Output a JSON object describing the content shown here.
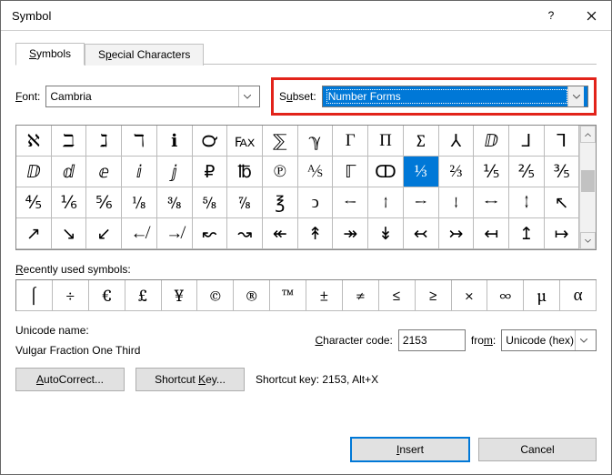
{
  "title": "Symbol",
  "tabs": {
    "symbols": "Symbols",
    "special": "Special Characters"
  },
  "font": {
    "label": "Font:",
    "value": "Cambria"
  },
  "subset": {
    "label": "Subset:",
    "value": "Number Forms"
  },
  "grid": [
    "ℵ",
    "ℶ",
    "ℷ",
    "ℸ",
    "ℹ",
    "℺",
    "℻",
    "⅀",
    "ℽ",
    "Γ",
    "Π",
    "∑",
    "⅄",
    "ⅅ",
    "⅃",
    "⅂",
    "ⅅ",
    "ⅆ",
    "ⅇ",
    "ⅈ",
    "ⅉ",
    "₽",
    "℔",
    "℗",
    "⅍",
    "ℾ",
    "ↀ",
    "⅓",
    "⅔",
    "⅕",
    "⅖",
    "⅗",
    "⅘",
    "⅙",
    "⅚",
    "⅛",
    "⅜",
    "⅝",
    "⅞",
    "℥",
    "ↄ",
    "←",
    "↑",
    "→",
    "↓",
    "↔",
    "↕",
    "↖",
    "↗",
    "↘",
    "↙",
    "↚",
    "↛",
    "↜",
    "↝",
    "↞",
    "↟",
    "↠",
    "↡",
    "↢",
    "↣",
    "↤",
    "↥",
    "↦"
  ],
  "grid_selected_index": 27,
  "recent_label": "Recently used symbols:",
  "recent": [
    "⌠",
    "÷",
    "€",
    "£",
    "¥",
    "©",
    "®",
    "™",
    "±",
    "≠",
    "≤",
    "≥",
    "×",
    "∞",
    "µ",
    "α"
  ],
  "unicode": {
    "label": "Unicode name:",
    "value": "Vulgar Fraction One Third"
  },
  "charcode": {
    "label": "Character code:",
    "value": "2153"
  },
  "from": {
    "label": "from:",
    "value": "Unicode (hex)"
  },
  "buttons": {
    "autocorrect": "AutoCorrect...",
    "shortcutkey": "Shortcut Key...",
    "shortcut_label": "Shortcut key: 2153, Alt+X",
    "insert": "Insert",
    "cancel": "Cancel"
  }
}
